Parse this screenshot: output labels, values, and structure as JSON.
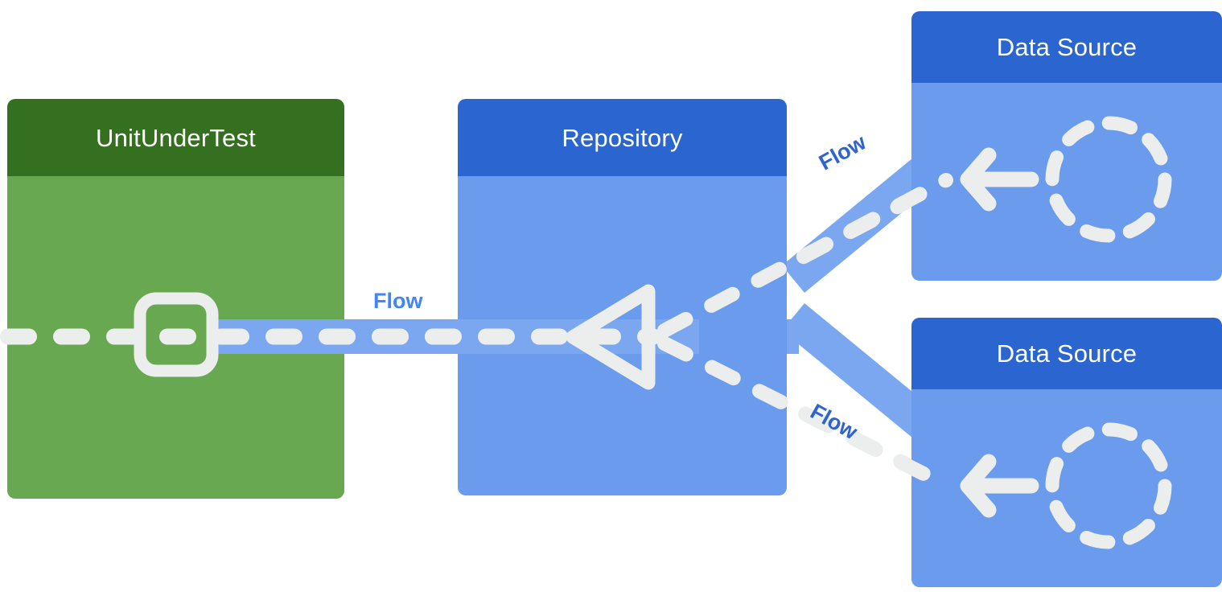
{
  "diagram": {
    "title_text_color": "#ffffff",
    "background": "#ffffff",
    "nodes": [
      {
        "id": "unit-under-test",
        "label": "UnitUnderTest",
        "header_color": "#34701f",
        "body_color": "#68a851",
        "icon": "rounded-square-icon"
      },
      {
        "id": "repository",
        "label": "Repository",
        "header_color": "#2a65d0",
        "body_color": "#6b9bec",
        "icon": "left-triangle-icon"
      },
      {
        "id": "data-source-1",
        "label": "Data Source",
        "header_color": "#2a65d0",
        "body_color": "#6b9bec",
        "icon": "dashed-circle-icon"
      },
      {
        "id": "data-source-2",
        "label": "Data Source",
        "header_color": "#2a65d0",
        "body_color": "#6b9bec",
        "icon": "dashed-circle-icon"
      }
    ],
    "connectors": [
      {
        "id": "flow-main",
        "label": "Flow",
        "label_color": "#4285f4",
        "band_color": "#7ba7f0",
        "dash_color": "#eceded"
      },
      {
        "id": "flow-upper",
        "label": "Flow",
        "label_color": "#2d64cf",
        "band_color": "#7ba7f0",
        "dash_color": "#eceded"
      },
      {
        "id": "flow-lower",
        "label": "Flow",
        "label_color": "#2d64cf",
        "band_color": "#7ba7f0",
        "dash_color": "#eceded"
      }
    ]
  }
}
